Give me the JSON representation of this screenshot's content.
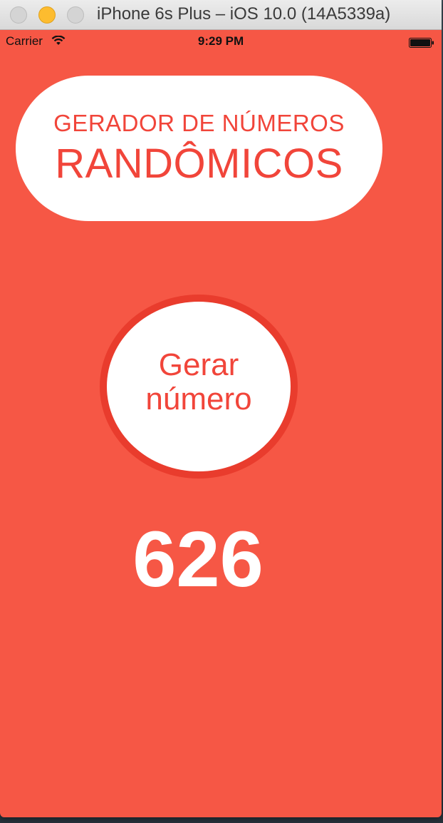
{
  "window": {
    "title": "iPhone 6s Plus – iOS 10.0 (14A5339a)"
  },
  "status_bar": {
    "carrier": "Carrier",
    "time": "9:29 PM",
    "icons": [
      "wifi-icon",
      "battery-icon"
    ]
  },
  "app": {
    "title_line1": "GERADOR DE NÚMEROS",
    "title_line2": "RANDÔMICOS",
    "button_line1": "Gerar",
    "button_line2": "número",
    "result": "626"
  },
  "colors": {
    "background": "#f65745",
    "accent": "#f1453a",
    "button_ring": "#e93c2d",
    "surface": "#ffffff"
  }
}
